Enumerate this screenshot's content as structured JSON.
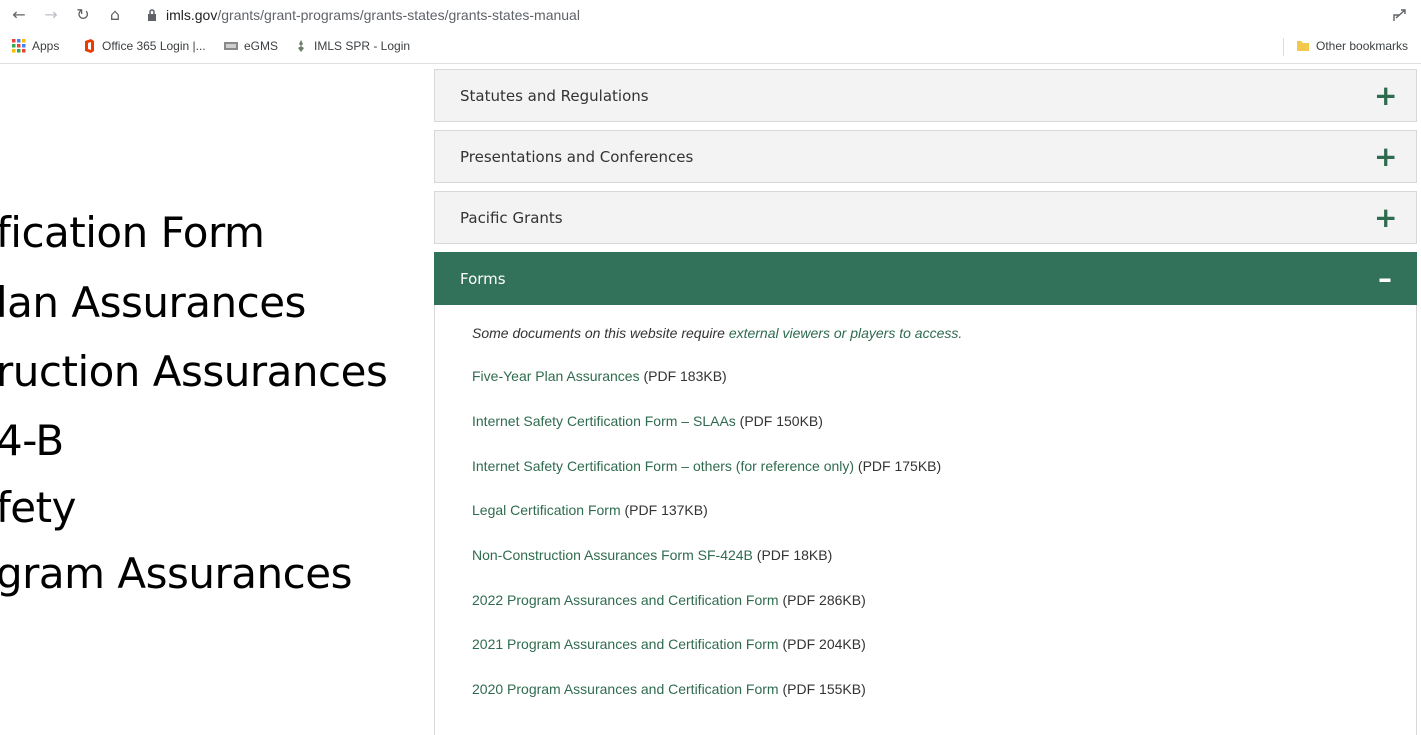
{
  "browser": {
    "url_domain": "imls.gov",
    "url_path": "/grants/grant-programs/grants-states/grants-states-manual"
  },
  "bookmarks": {
    "apps": "Apps",
    "office": "Office 365 Login |...",
    "egms": "eGMS",
    "imls_spr": "IMLS SPR - Login",
    "other": "Other bookmarks"
  },
  "slide": {
    "lines": [
      "fication Form",
      "lan Assurances",
      "ruction Assurances",
      "4-B",
      "fety",
      "gram Assurances"
    ]
  },
  "accordion": {
    "statutes": "Statutes and Regulations",
    "presentations": "Presentations and Conferences",
    "pacific": "Pacific Grants",
    "forms": "Forms",
    "plus": "+",
    "minus": "–"
  },
  "forms_panel": {
    "note_prefix": "Some documents on this website require ",
    "note_link": "external viewers or players to access.",
    "links": [
      {
        "label": "Five-Year Plan Assurances",
        "size": " (PDF 183KB)"
      },
      {
        "label": "Internet Safety Certification Form – SLAAs",
        "size": " (PDF 150KB)"
      },
      {
        "label": "Internet Safety Certification Form – others (for reference only)",
        "size": " (PDF 175KB)"
      },
      {
        "label": "Legal Certification Form",
        "size": " (PDF 137KB)"
      },
      {
        "label": "Non-Construction Assurances Form SF-424B",
        "size": " (PDF 18KB)"
      },
      {
        "label": "2022 Program Assurances and Certification Form",
        "size": " (PDF 286KB)"
      },
      {
        "label": "2021 Program Assurances and Certification Form",
        "size": " (PDF 204KB)"
      },
      {
        "label": "2020 Program Assurances and Certification Form",
        "size": " (PDF 155KB)"
      }
    ]
  },
  "colors": {
    "accent_green": "#33725a",
    "link_green": "#2f6b4f"
  }
}
